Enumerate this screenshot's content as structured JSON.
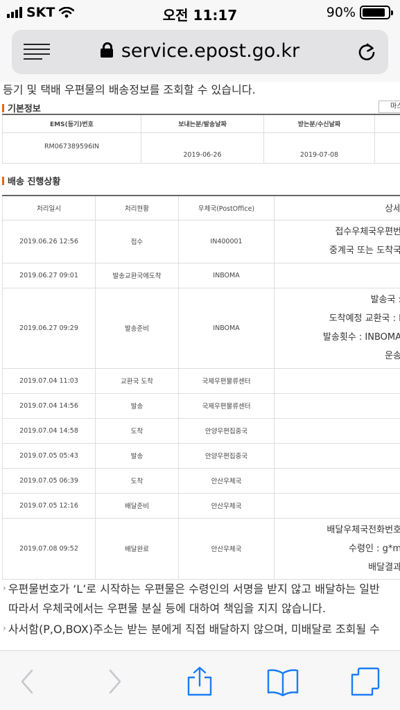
{
  "status_bar": {
    "carrier": "SKT",
    "time": "오전 11:17",
    "battery": "90%",
    "battery_level": 0.9
  },
  "browser": {
    "url": "service.epost.go.kr"
  },
  "page": {
    "intro_text": "등기 및 택배 우편물의 배송정보를 조회할 수 있습니다.",
    "basic_title": "기본정보",
    "more_button": "마스",
    "basic_headers": [
      "EMS(등기)번호",
      "보내는분/발송날짜",
      "받는분/수신날짜"
    ],
    "basic_values": [
      "RM067389596IN",
      "2019-06-26",
      "2019-07-08"
    ],
    "track_title": "배송 진행상황",
    "track_headers": [
      "처리일시",
      "처리현황",
      "우체국(PostOffice)",
      "상세"
    ],
    "rows": [
      {
        "time": "2019.06.26 12:56",
        "status": "접수",
        "office": "IN400001",
        "detail": [
          "접수우체국우편번",
          "중계국 또는 도착국"
        ]
      },
      {
        "time": "2019.06.27 09:01",
        "status": "발송교환국에도착",
        "office": "INBOMA",
        "detail": []
      },
      {
        "time": "2019.06.27 09:29",
        "status": "발송준비",
        "office": "INBOMA",
        "detail": [
          "발송국 :",
          "도착예정 교환국 : I",
          "발송횟수 : INBOMA",
          "운송"
        ]
      },
      {
        "time": "2019.07.04 11:03",
        "status": "교환국 도착",
        "office": "국제우편물류센터",
        "detail": []
      },
      {
        "time": "2019.07.04 14:56",
        "status": "발송",
        "office": "국제우편물류센터",
        "detail": []
      },
      {
        "time": "2019.07.04 14:58",
        "status": "도착",
        "office": "안양우편집중국",
        "detail": []
      },
      {
        "time": "2019.07.05 05:43",
        "status": "발송",
        "office": "안양우편집중국",
        "detail": []
      },
      {
        "time": "2019.07.05 06:39",
        "status": "도착",
        "office": "안산우체국",
        "detail": []
      },
      {
        "time": "2019.07.05 12:16",
        "status": "배달준비",
        "office": "안산우체국",
        "detail": []
      },
      {
        "time": "2019.07.08 09:52",
        "status": "배달완료",
        "office": "안산우체국",
        "detail": [
          "배달우체국전화번호",
          "수령인 : g*m",
          "배달결과"
        ]
      }
    ],
    "notes": [
      "우편물번호가 ‘L’로 시작하는 우편물은 수령인의 서명을 받지 않고 배달하는 일반",
      "따라서 우체국에서는 우편물 분실 등에 대하여 책임을 지지 않습니다.",
      "사서함(P,O,BOX)주소는 받는 분에게 직접 배달하지 않으며, 미배달로 조회될 수"
    ]
  },
  "toolbar": {
    "icons": [
      "back-icon",
      "forward-icon",
      "share-icon",
      "bookmarks-icon",
      "tabs-icon"
    ]
  },
  "colors": {
    "accent": "#e06b1f",
    "ios_blue": "#1a7cf5",
    "disabled": "#c7c7cc"
  }
}
